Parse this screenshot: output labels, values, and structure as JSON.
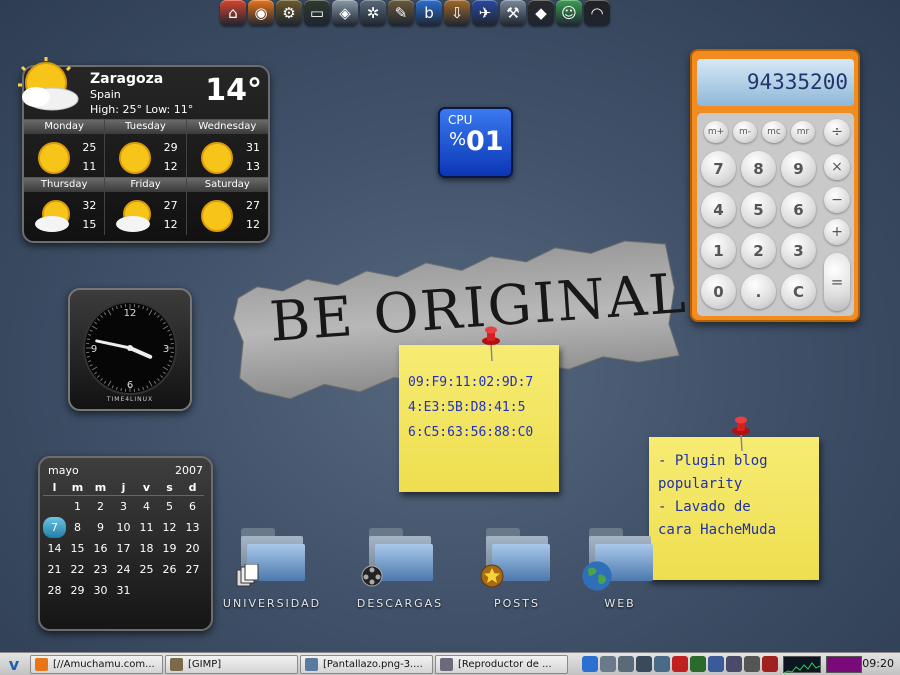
{
  "launcher": {
    "icons": [
      {
        "name": "home-icon",
        "glyph": "⌂",
        "color": "#d8442c"
      },
      {
        "name": "firefox-icon",
        "glyph": "◉",
        "color": "#e8751a"
      },
      {
        "name": "settings-icon",
        "glyph": "⚙",
        "color": "#6b5a2a"
      },
      {
        "name": "terminal-icon",
        "glyph": "▭",
        "color": "#2f3a2f"
      },
      {
        "name": "dock-icon",
        "glyph": "◈",
        "color": "#8a9aa8"
      },
      {
        "name": "aperture-icon",
        "glyph": "✲",
        "color": "#5a6a7a"
      },
      {
        "name": "gimp-icon",
        "glyph": "✎",
        "color": "#6a5a3a"
      },
      {
        "name": "blog-icon",
        "glyph": "b",
        "color": "#2b6fd1"
      },
      {
        "name": "download-icon",
        "glyph": "⇩",
        "color": "#a26a2a"
      },
      {
        "name": "bird-icon",
        "glyph": "✈",
        "color": "#2a4aa0"
      },
      {
        "name": "network-tool-icon",
        "glyph": "⚒",
        "color": "#7a8a9a"
      },
      {
        "name": "inkscape-icon",
        "glyph": "◆",
        "color": "#2a2a2a"
      },
      {
        "name": "messenger-icon",
        "glyph": "☺",
        "color": "#3aa050"
      },
      {
        "name": "wireless-icon",
        "glyph": "◠",
        "color": "#222222"
      }
    ]
  },
  "weather": {
    "city": "Zaragoza",
    "country": "Spain",
    "high_low": "High: 25°  Low: 11°",
    "temperature": "14°",
    "days": [
      {
        "name": "Monday",
        "hi": "25",
        "lo": "11",
        "icon": "sun-icon"
      },
      {
        "name": "Tuesday",
        "hi": "29",
        "lo": "12",
        "icon": "sun-icon"
      },
      {
        "name": "Wednesday",
        "hi": "31",
        "lo": "13",
        "icon": "sun-icon"
      },
      {
        "name": "Thursday",
        "hi": "32",
        "lo": "15",
        "icon": "partly-cloudy-icon"
      },
      {
        "name": "Friday",
        "hi": "27",
        "lo": "12",
        "icon": "partly-cloudy-icon"
      },
      {
        "name": "Saturday",
        "hi": "27",
        "lo": "12",
        "icon": "sun-icon"
      }
    ]
  },
  "cpu": {
    "label": "CPU",
    "percent_sign": "%",
    "value": "01"
  },
  "calculator": {
    "display": "94335200",
    "memory_keys": [
      "m+",
      "m-",
      "mc",
      "mr"
    ],
    "number_keys": [
      "7",
      "8",
      "9",
      "4",
      "5",
      "6",
      "1",
      "2",
      "3",
      "0",
      ".",
      "C"
    ],
    "operator_keys": [
      "÷",
      "×",
      "−",
      "+"
    ],
    "equals_key": "="
  },
  "clock": {
    "numerals": {
      "12": "12",
      "3": "3",
      "6": "6",
      "9": "9"
    },
    "brand": "TIME4LINUX",
    "hour": 3,
    "minute": 47
  },
  "banner": {
    "text": "BE ORIGINAL"
  },
  "mac_note": {
    "lines": [
      "09:F9:11:02:9D:7",
      "4:E3:5B:D8:41:5",
      "6:C5:63:56:88:C0"
    ]
  },
  "todo_note": {
    "lines": [
      "- Plugin blog",
      "popularity",
      "- Lavado de",
      "cara HacheMuda"
    ]
  },
  "calendar": {
    "month": "mayo",
    "year": "2007",
    "weekdays": [
      "l",
      "m",
      "m",
      "j",
      "v",
      "s",
      "d"
    ],
    "cells": [
      "",
      "1",
      "2",
      "3",
      "4",
      "5",
      "6",
      "7",
      "8",
      "9",
      "10",
      "11",
      "12",
      "13",
      "14",
      "15",
      "16",
      "17",
      "18",
      "19",
      "20",
      "21",
      "22",
      "23",
      "24",
      "25",
      "26",
      "27",
      "28",
      "29",
      "30",
      "31",
      "",
      "",
      ""
    ],
    "today": "7"
  },
  "folders": [
    {
      "label": "UNIVERSIDAD",
      "emblem": "documents-icon"
    },
    {
      "label": "DESCARGAS",
      "emblem": "film-reel-icon"
    },
    {
      "label": "POSTS",
      "emblem": "star-icon"
    },
    {
      "label": "WEB",
      "emblem": "globe-icon"
    }
  ],
  "taskbar": {
    "start_glyph": "v",
    "tasks": [
      {
        "label": "[//Amuchamu.com...",
        "icon": "firefox-icon",
        "color": "#e8751a"
      },
      {
        "label": "[GIMP]",
        "icon": "gimp-icon",
        "color": "#7a6a4a"
      },
      {
        "label": "[Pantallazo.png-3....",
        "icon": "image-viewer-icon",
        "color": "#5a7aa0"
      },
      {
        "label": "[Reproductor de ...",
        "icon": "media-player-icon",
        "color": "#6a6a7a"
      }
    ],
    "tray": [
      {
        "name": "blog-tray-icon",
        "color": "#2b6fd1"
      },
      {
        "name": "search-tray-icon",
        "color": "#6a7a8a"
      },
      {
        "name": "magnifier-tray-icon",
        "color": "#5a6a7a"
      },
      {
        "name": "screenshot-tray-icon",
        "color": "#3a4a5a"
      },
      {
        "name": "display-tray-icon",
        "color": "#4a6a8a"
      },
      {
        "name": "ruby-tray-icon",
        "color": "#c02020"
      },
      {
        "name": "terminal-tray-icon",
        "color": "#2a6a2a"
      },
      {
        "name": "network-tray-icon",
        "color": "#3a5a9a"
      },
      {
        "name": "monitor-tray-icon",
        "color": "#4a4a6a"
      },
      {
        "name": "volume-tray-icon",
        "color": "#555555"
      },
      {
        "name": "battery-tray-icon",
        "color": "#a02020"
      }
    ],
    "clock": "09:20"
  },
  "colors": {
    "desktop": "#41526a",
    "calculator_frame": "#f28c1e",
    "cpu_blue": "#0b36b6",
    "note_yellow": "#f7ec73",
    "ink_blue": "#2030c0"
  }
}
